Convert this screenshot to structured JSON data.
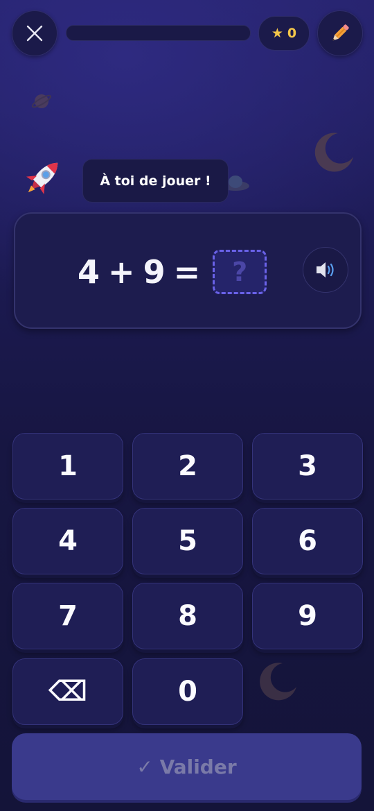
{
  "header": {
    "close_icon": "close-icon",
    "progress": 0,
    "stars_icon": "star-icon",
    "stars_count": "0",
    "pencil_icon": "pencil-icon"
  },
  "prompt": {
    "mascot_icon": "rocket-icon",
    "bubble_text": "À toi de jouer !"
  },
  "question": {
    "operand_a": "4",
    "operator": "+",
    "operand_b": "9",
    "equals": "=",
    "answer_placeholder": "?",
    "sound_icon": "speaker-icon"
  },
  "keypad": {
    "k1": "1",
    "k2": "2",
    "k3": "3",
    "k4": "4",
    "k5": "5",
    "k6": "6",
    "k7": "7",
    "k8": "8",
    "k9": "9",
    "backspace": "⌫",
    "k0": "0"
  },
  "validate_label": "✓ Valider",
  "colors": {
    "accent": "#6a62e8",
    "star": "#f3c64a",
    "background": "#1d1b55"
  }
}
